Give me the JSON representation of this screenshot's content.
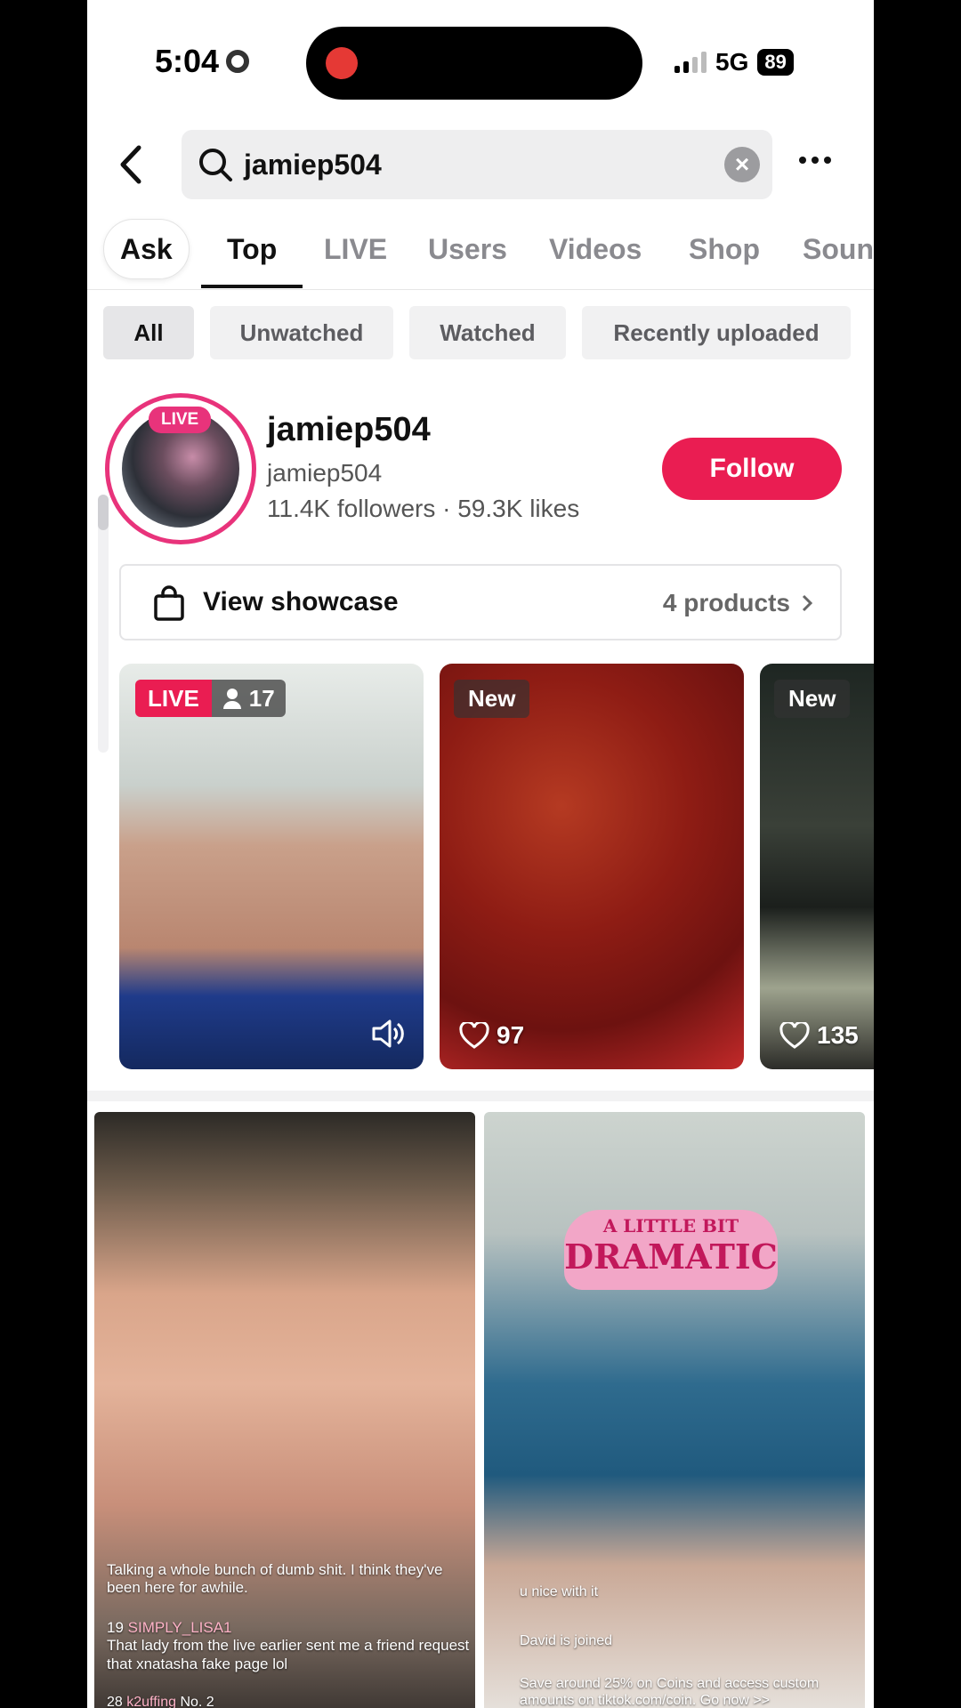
{
  "status": {
    "time": "5:04",
    "network": "5G",
    "battery": "89"
  },
  "search": {
    "query": "jamiep504"
  },
  "tabs": [
    {
      "label": "Ask"
    },
    {
      "label": "Top"
    },
    {
      "label": "LIVE"
    },
    {
      "label": "Users"
    },
    {
      "label": "Videos"
    },
    {
      "label": "Shop"
    },
    {
      "label": "Soun"
    }
  ],
  "filters": [
    {
      "label": "All"
    },
    {
      "label": "Unwatched"
    },
    {
      "label": "Watched"
    },
    {
      "label": "Recently uploaded"
    }
  ],
  "user": {
    "live_badge": "LIVE",
    "display_name": "jamiep504",
    "username": "jamiep504",
    "stats": "11.4K followers · 59.3K likes",
    "follow_label": "Follow"
  },
  "showcase": {
    "label": "View showcase",
    "products": "4 products"
  },
  "thumbnails": [
    {
      "badge": "LIVE",
      "viewers": "17"
    },
    {
      "badge": "New",
      "likes": "97"
    },
    {
      "badge": "New",
      "likes": "135"
    }
  ],
  "videos": [
    {
      "caption1": "Talking a whole bunch of dumb shit. I think they've been here for awhile.",
      "comment_level": "19",
      "comment_user": "SIMPLY_LISA1",
      "comment_text": "That lady from the live earlier sent me a friend request that xnatasha fake page lol",
      "footer_level": "28",
      "footer_user": "k2uffing",
      "footer_rank": "No. 2"
    },
    {
      "sticker_top": "A LITTLE BIT",
      "sticker_main": "DRAMATIC",
      "line1": "u nice with it",
      "line2": "David is joined",
      "promo": "Save around 25% on Coins and access custom amounts on tiktok.com/coin. Go now >>"
    }
  ],
  "colors": {
    "accent": "#ea1d52",
    "live_pink": "#e8337b"
  }
}
